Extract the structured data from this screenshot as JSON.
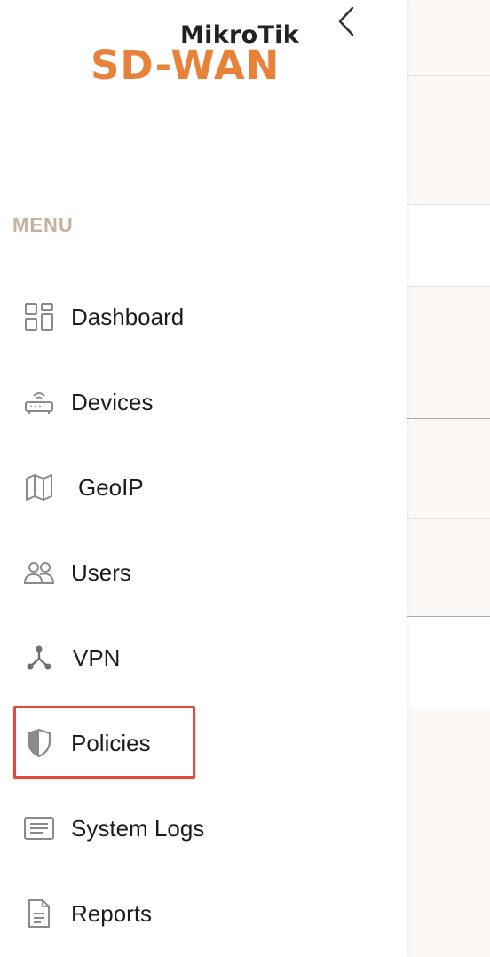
{
  "brand": {
    "top": "MikroTik",
    "main": "SD-WAN",
    "accent_color": "#e8813a"
  },
  "menu": {
    "heading": "MENU",
    "items": [
      {
        "label": "Dashboard",
        "icon": "dashboard-grid-icon"
      },
      {
        "label": "Devices",
        "icon": "router-icon"
      },
      {
        "label": "GeoIP",
        "icon": "map-icon"
      },
      {
        "label": "Users",
        "icon": "users-icon"
      },
      {
        "label": "VPN",
        "icon": "network-branch-icon"
      },
      {
        "label": "Policies",
        "icon": "shield-icon",
        "highlighted": true
      },
      {
        "label": "System Logs",
        "icon": "logs-icon"
      },
      {
        "label": "Reports",
        "icon": "document-icon"
      }
    ]
  },
  "highlight_color": "#e24a3b"
}
